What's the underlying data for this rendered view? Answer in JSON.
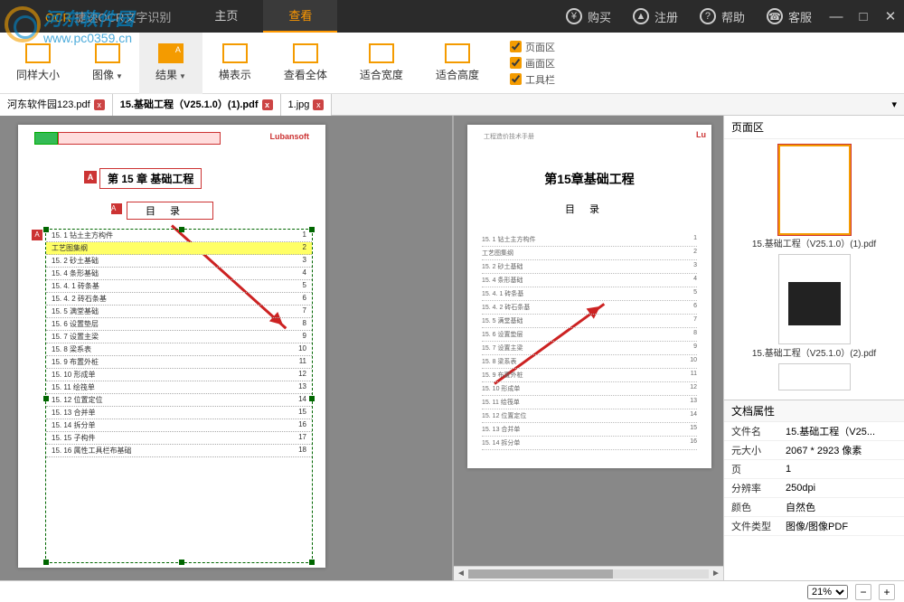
{
  "app": {
    "title_prefix": "OCR",
    "title": "捷速OCR文字识别"
  },
  "menu": {
    "home": "主页",
    "view": "查看"
  },
  "header_buttons": {
    "buy": "购买",
    "register": "注册",
    "help": "帮助",
    "service": "客服"
  },
  "toolbar": {
    "same_size": "同样大小",
    "image": "图像",
    "result": "结果",
    "horizontal": "横表示",
    "view_all": "查看全体",
    "fit_width": "适合宽度",
    "fit_height": "适合高度",
    "checks": {
      "page_area": "页面区",
      "image_area": "画面区",
      "toolbar": "工具栏"
    }
  },
  "tabs": {
    "t1": "河东软件园123.pdf",
    "t2": "15.基础工程（V25.1.0）(1).pdf",
    "t3": "1.jpg"
  },
  "doc": {
    "brand": "Lubansoft",
    "chapter": "第 15 章 基础工程",
    "chapter_plain": "第15章基础工程",
    "mulu": "目录",
    "subheader": "工程造价技术手册",
    "toc": [
      "15. 1 钻土主方构件",
      "工艺图集纲",
      "15. 2 砂土基础",
      "15. 4 条形基础",
      "15. 4. 1 砖条基",
      "15. 4. 2 砖石条基",
      "15. 5 满堂基础",
      "15. 6 设置垫层",
      "15. 7 设置主梁",
      "15. 8 梁系表",
      "15. 9 布置外桩",
      "15. 10 形成单",
      "15. 11 绘筏单",
      "15. 12 位置定位",
      "15. 13 合并单",
      "15. 14 拆分单",
      "15. 15 子构件",
      "15. 16 属性工具栏布基础"
    ]
  },
  "sidebar": {
    "page_area": "页面区",
    "thumb1": "15.基础工程（V25.1.0）(1).pdf",
    "thumb2": "15.基础工程（V25.1.0）(2).pdf",
    "props_title": "文档属性",
    "props": {
      "filename_k": "文件名",
      "filename_v": "15.基础工程（V25...",
      "size_k": "元大小",
      "size_v": "2067 * 2923 像素",
      "page_k": "页",
      "page_v": "1",
      "dpi_k": "分辨率",
      "dpi_v": "250dpi",
      "color_k": "颜色",
      "color_v": "自然色",
      "type_k": "文件类型",
      "type_v": "图像/图像PDF"
    }
  },
  "status": {
    "zoom": "21%"
  },
  "watermark": {
    "name": "河东软件园",
    "url": "www.pc0359.cn"
  }
}
